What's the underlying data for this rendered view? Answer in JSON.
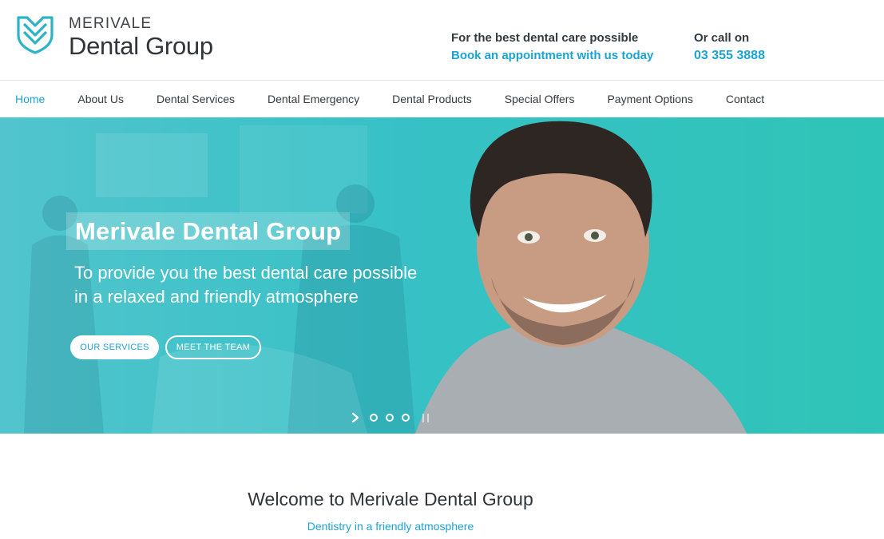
{
  "brand": {
    "line1": "MERIVALE",
    "line2": "Dental Group",
    "accent": "#1ba3d3",
    "logo_color": "#2bb3c8"
  },
  "header": {
    "care_label": "For the best dental care possible",
    "care_link": "Book an appointment with us today",
    "call_label": "Or call on",
    "call_number": "03 355 3888"
  },
  "nav": {
    "items": [
      {
        "label": "Home",
        "active": true
      },
      {
        "label": "About Us"
      },
      {
        "label": "Dental Services"
      },
      {
        "label": "Dental Emergency"
      },
      {
        "label": "Dental Products"
      },
      {
        "label": "Special Offers"
      },
      {
        "label": "Payment Options"
      },
      {
        "label": "Contact"
      }
    ]
  },
  "hero": {
    "title": "Merivale Dental Group",
    "subtitle_line1": "To provide you the best dental care possible",
    "subtitle_line2": "in a relaxed and friendly atmosphere",
    "btn_services": "OUR SERVICES",
    "btn_team": "MEET THE TEAM",
    "slide_count": 3,
    "bg_color": "#2fbfc4"
  },
  "welcome": {
    "title": "Welcome to Merivale Dental Group",
    "subtitle": "Dentistry in a friendly atmosphere"
  }
}
